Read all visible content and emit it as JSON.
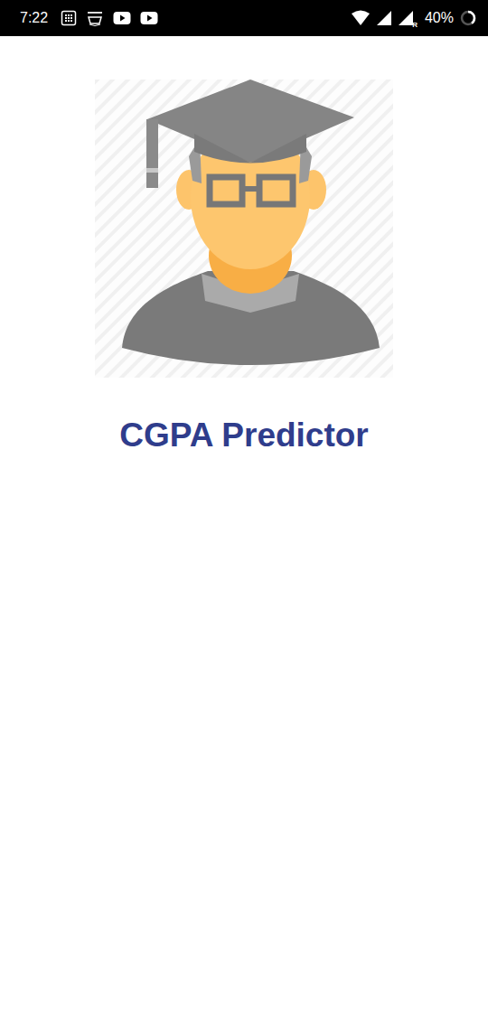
{
  "status_bar": {
    "time": "7:22",
    "network_badge": "R",
    "battery": "40%",
    "battery_level": 0.4
  },
  "title": "CGPA Predictor"
}
